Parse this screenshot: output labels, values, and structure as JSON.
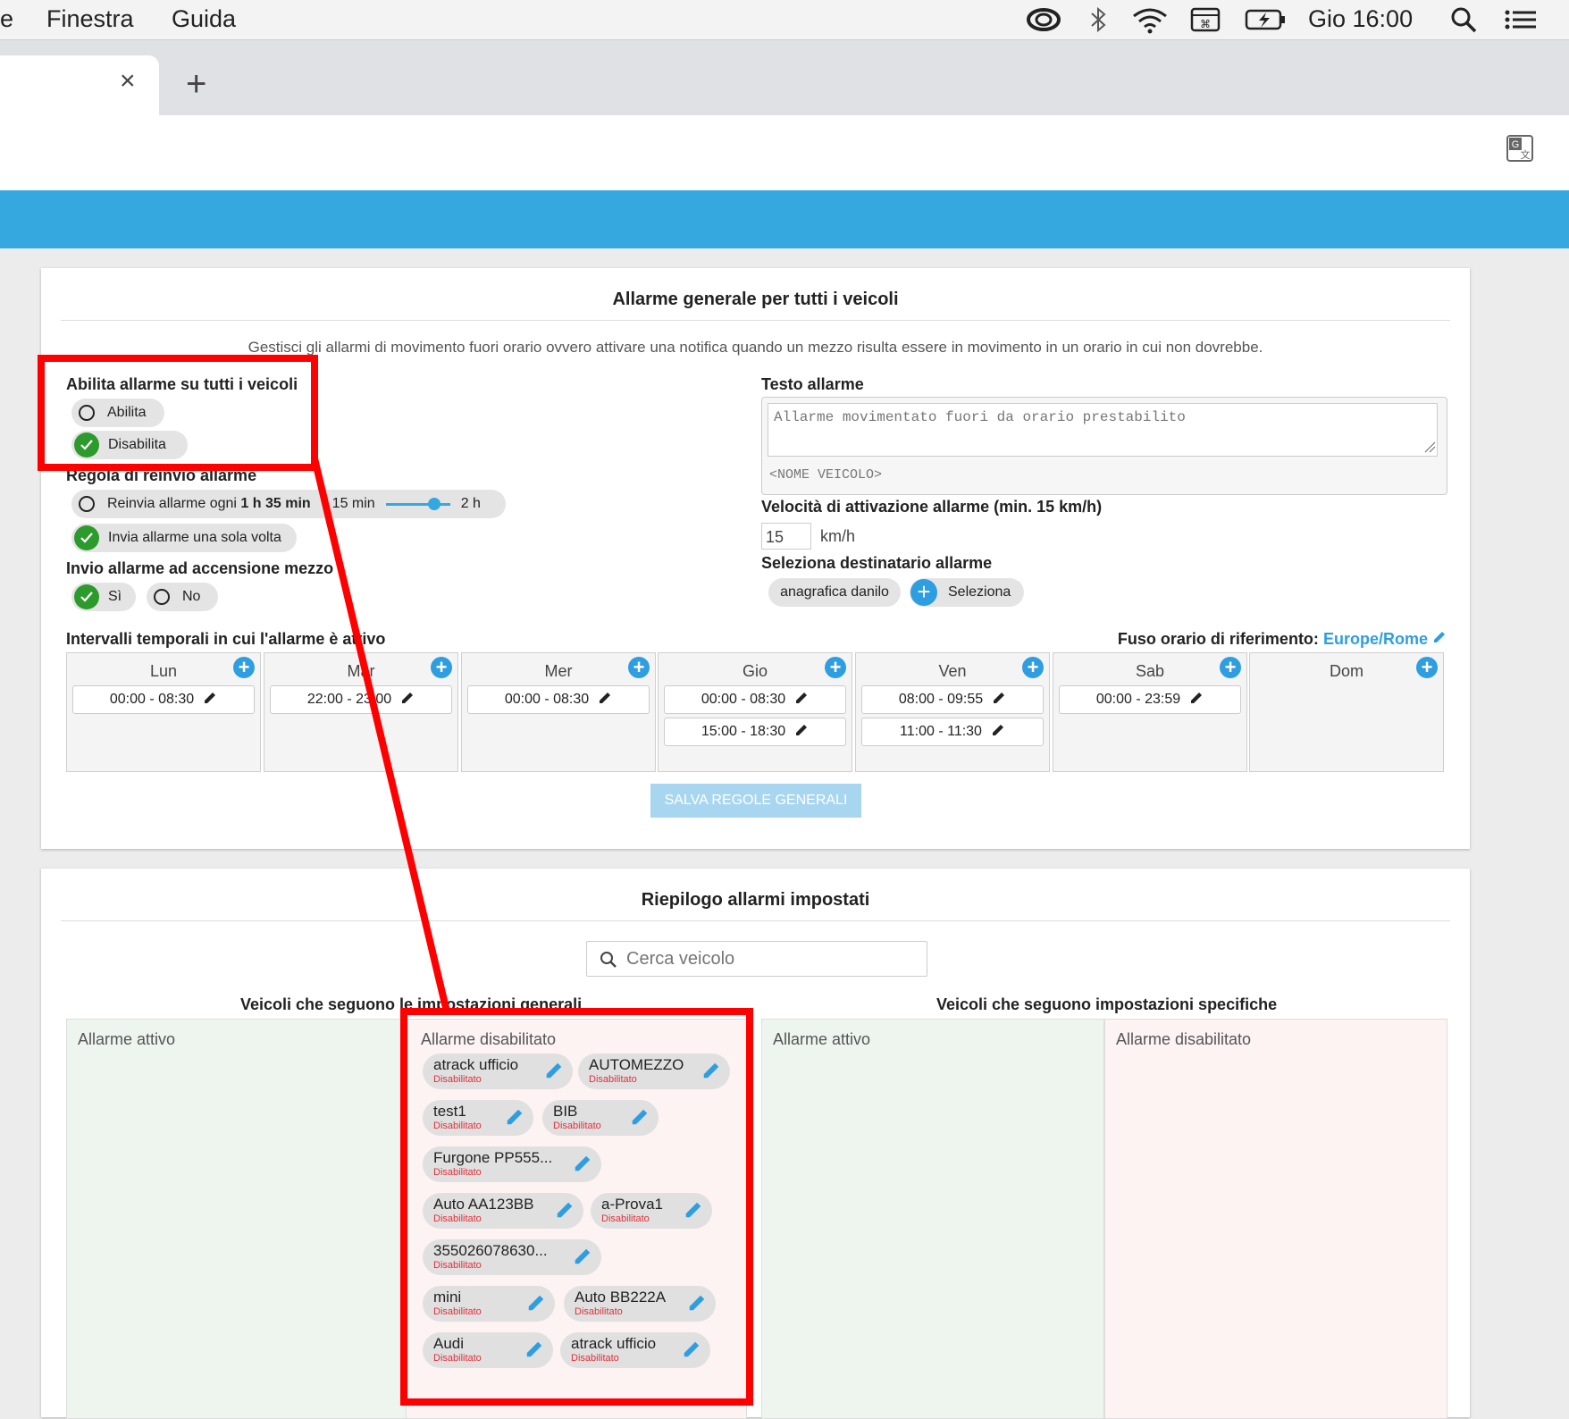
{
  "menubar": {
    "items": [
      "e",
      "Finestra",
      "Guida"
    ],
    "clock": "Gio 16:00"
  },
  "browser": {
    "close_tab": "×",
    "new_tab": "+"
  },
  "general": {
    "title": "Allarme generale per tutti i veicoli",
    "description": "Gestisci gli allarmi di movimento fuori orario ovvero attivare una notifica quando un mezzo risulta essere in movimento in un orario in cui non dovrebbe.",
    "enable_label": "Abilita allarme su tutti i veicoli",
    "enable_option": "Abilita",
    "disable_option": "Disabilita",
    "resend_label": "Regola di reinvio allarme",
    "resend_every_prefix": "Reinvia allarme ogni",
    "resend_every_value": "1 h 35 min",
    "slider_min": "15 min",
    "slider_max": "2 h",
    "slider_position": 0.75,
    "send_once": "Invia allarme una sola volta",
    "ignition_label": "Invio allarme ad accensione mezzo",
    "ignition_yes": "Sì",
    "ignition_no": "No",
    "text_label": "Testo allarme",
    "text_value": "Allarme movimentato fuori da orario prestabilito",
    "text_tag": "<NOME VEICOLO>",
    "speed_label": "Velocità di attivazione allarme (min. 15 km/h)",
    "speed_value": "15",
    "speed_unit": "km/h",
    "recipient_label": "Seleziona destinatario allarme",
    "recipient_name": "anagrafica danilo",
    "recipient_select": "Seleziona",
    "intervals_label": "Intervalli temporali in cui l'allarme è attivo",
    "timezone_label": "Fuso orario di riferimento:",
    "timezone_value": "Europe/Rome",
    "save_button": "SALVA REGOLE GENERALI",
    "days": [
      {
        "name": "Lun",
        "slots": [
          "00:00 - 08:30"
        ]
      },
      {
        "name": "Mar",
        "slots": [
          "22:00 - 23:00"
        ]
      },
      {
        "name": "Mer",
        "slots": [
          "00:00 - 08:30"
        ]
      },
      {
        "name": "Gio",
        "slots": [
          "00:00 - 08:30",
          "15:00 - 18:30"
        ]
      },
      {
        "name": "Ven",
        "slots": [
          "08:00 - 09:55",
          "11:00 - 11:30"
        ]
      },
      {
        "name": "Sab",
        "slots": [
          "00:00 - 23:59"
        ]
      },
      {
        "name": "Dom",
        "slots": []
      }
    ]
  },
  "summary": {
    "title": "Riepilogo allarmi impostati",
    "search_placeholder": "Cerca veicolo",
    "general_heading": "Veicoli che seguono le impostazioni generali",
    "specific_heading": "Veicoli che seguono impostazioni specifiche",
    "active_label": "Allarme attivo",
    "disabled_label": "Allarme disabilitato",
    "status_disabled": "Disabilitato",
    "vehicles": [
      "atrack ufficio",
      "AUTOMEZZO",
      "test1",
      "BIB",
      "Furgone PP555...",
      "Auto AA123BB",
      "a-Prova1",
      "355026078630...",
      "mini",
      "Auto BB222A",
      "Audi",
      "atrack ufficio"
    ]
  },
  "colors": {
    "accent": "#35a8df",
    "check": "#2c9a2c",
    "highlight": "#ff0000",
    "status": "#e0303a"
  }
}
